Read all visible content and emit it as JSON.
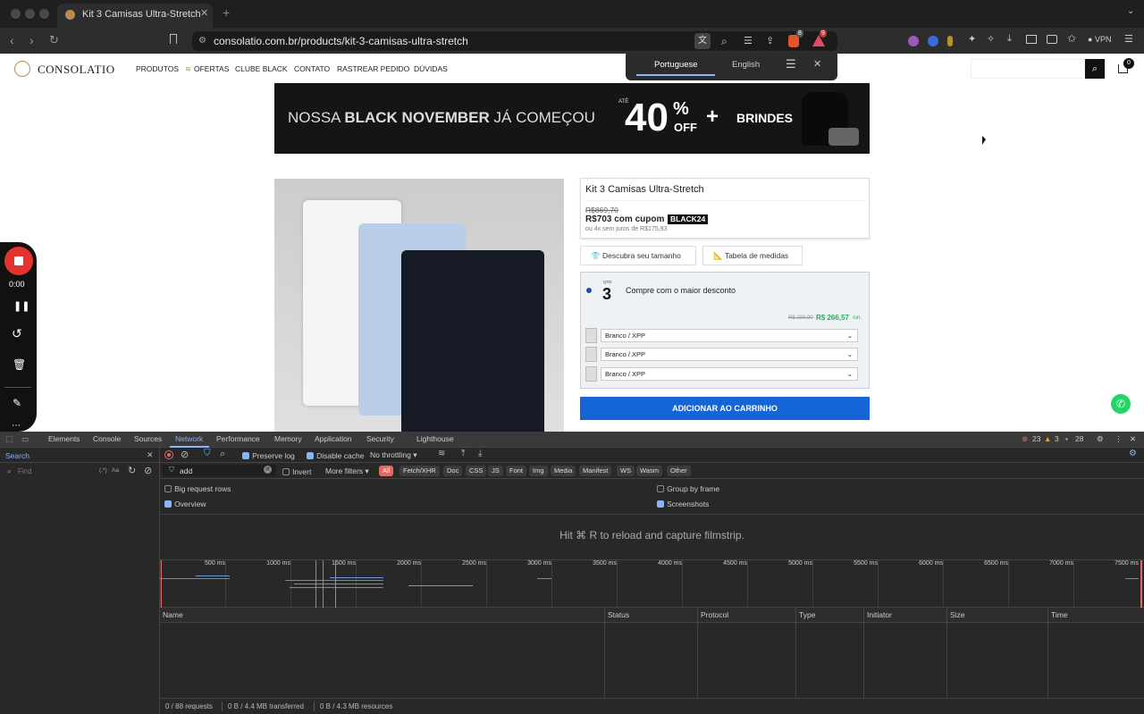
{
  "browser": {
    "tab_title": "Kit 3 Camisas Ultra-Stretch",
    "new_tab": "+",
    "url": "consolatio.com.br/products/kit-3-camisas-ultra-stretch",
    "vpn": "VPN",
    "badge_brave": "8",
    "badge_alert": "9"
  },
  "translate": {
    "lang_from": "Portuguese",
    "lang_to": "English"
  },
  "site": {
    "logo": "CONSOLATIO",
    "nav": [
      "PRODUTOS",
      "OFERTAS",
      "CLUBE BLACK",
      "CONTATO",
      "RASTREAR PEDIDO",
      "DÚVIDAS"
    ],
    "cart_count": "0",
    "banner": {
      "left_a": "NOSSA",
      "left_b": "BLACK NOVEMBER",
      "left_c": "JÁ COMEÇOU",
      "ate": "ATÉ",
      "pct": "40",
      "pct_sym": "%",
      "off": "OFF",
      "plus": "+",
      "gift": "BRINDES"
    },
    "product": {
      "title": "Kit 3 Camisas Ultra-Stretch",
      "old_price": "R$869,70",
      "price": "R$703 com cupom",
      "coupon": "BLACK24",
      "installments": "ou 4x sem juros de R$175,93",
      "size_btn": "Descubra seu tamanho",
      "table_btn": "Tabela de medidas",
      "qty_label": "QTD",
      "qty": "3",
      "offer": "Compre com o maior desconto",
      "offer_old": "R$ 289,90",
      "offer_new": "R$ 266,57",
      "offer_unit": "/un.",
      "variants": [
        "Branco / XPP",
        "Branco / XPP",
        "Branco / XPP"
      ],
      "add_to_cart": "ADICIONAR AO CARRINHO"
    }
  },
  "recorder": {
    "time": "0:00"
  },
  "devtools": {
    "tabs": [
      "Elements",
      "Console",
      "Sources",
      "Network",
      "Performance",
      "Memory",
      "Application",
      "Security",
      "Lighthouse"
    ],
    "errors": "23",
    "warnings": "3",
    "messages": "28",
    "search_label": "Search",
    "find_placeholder": "Find",
    "regex": "(.*)",
    "case": "Aa",
    "preserve_log": "Preserve log",
    "disable_cache": "Disable cache",
    "throttle": "No throttling",
    "filter_value": "add",
    "invert": "Invert",
    "more_filters": "More filters",
    "filter_types": [
      "All",
      "Fetch/XHR",
      "Doc",
      "CSS",
      "JS",
      "Font",
      "Img",
      "Media",
      "Manifest",
      "WS",
      "Wasm",
      "Other"
    ],
    "big_rows": "Big request rows",
    "overview": "Overview",
    "group_frame": "Group by frame",
    "screenshots": "Screenshots",
    "film_msg": "Hit ⌘ R to reload and capture filmstrip.",
    "ticks": [
      "500 ms",
      "1000 ms",
      "1500 ms",
      "2000 ms",
      "2500 ms",
      "3000 ms",
      "3500 ms",
      "4000 ms",
      "4500 ms",
      "5000 ms",
      "5500 ms",
      "6000 ms",
      "6500 ms",
      "7000 ms",
      "7500 ms"
    ],
    "columns": [
      "Name",
      "Status",
      "Protocol",
      "Type",
      "Initiator",
      "Size",
      "Time"
    ],
    "status": {
      "requests": "0 / 88 requests",
      "transferred": "0 B / 4.4 MB transferred",
      "resources": "0 B / 4.3 MB resources"
    },
    "colors": {
      "accent": "#8ab4f8",
      "error": "#e46962",
      "warning": "#f2a600"
    }
  }
}
